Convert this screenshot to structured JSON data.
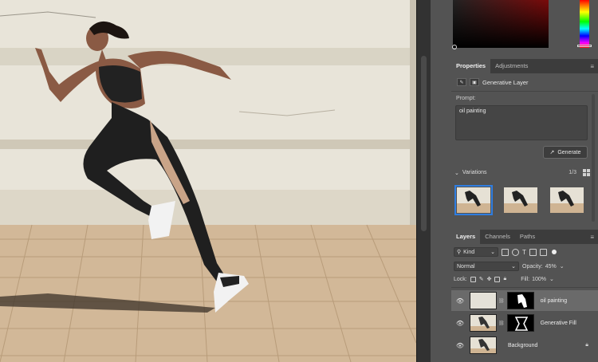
{
  "properties_panel": {
    "tabs": [
      "Properties",
      "Adjustments"
    ],
    "layer_type": "Generative Layer",
    "prompt_label": "Prompt:",
    "prompt_value": "oil painting",
    "generate_label": "Generate",
    "variations_label": "Variations",
    "variations_count": "1/3"
  },
  "layers_panel": {
    "tabs": [
      "Layers",
      "Channels",
      "Paths"
    ],
    "filter_kind": "Kind",
    "blend_mode": "Normal",
    "opacity_label": "Opacity:",
    "opacity_value": "45%",
    "lock_label": "Lock:",
    "fill_label": "Fill:",
    "fill_value": "100%",
    "layers": [
      {
        "name": "oil painting",
        "selected": true
      },
      {
        "name": "Generative Fill",
        "selected": false
      },
      {
        "name": "Background",
        "selected": false,
        "locked": true
      }
    ]
  },
  "colors": {
    "accent": "#2f7de0",
    "panel_bg": "#535353",
    "selected_layer": "#6a6a6a"
  },
  "icons": [
    "eyedropper-icon",
    "generative-layer-icon",
    "generate-icon",
    "grid-view-icon",
    "chevron-down-icon",
    "eye-icon",
    "link-icon",
    "lock-icon",
    "panel-menu-icon"
  ]
}
